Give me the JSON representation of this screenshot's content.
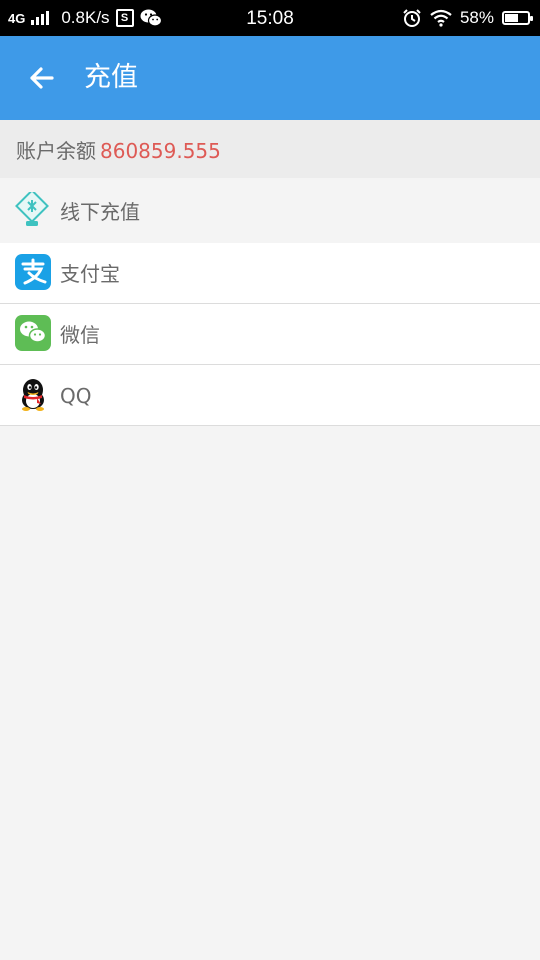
{
  "status_bar": {
    "network": "4G",
    "speed": "0.8K/s",
    "time": "15:08",
    "battery": "58%",
    "battery_level": 0.58
  },
  "app_bar": {
    "title": "充值"
  },
  "balance": {
    "label": "账户余额",
    "amount": "860859.555",
    "amount_color": "#de5a55"
  },
  "payment_methods": [
    {
      "label": "线下充值",
      "icon": "offline-recharge-icon"
    },
    {
      "label": "支付宝",
      "icon": "alipay-icon"
    },
    {
      "label": "微信",
      "icon": "wechat-icon"
    },
    {
      "label": "QQ",
      "icon": "qq-icon"
    }
  ],
  "colors": {
    "app_bar": "#3e9ae8",
    "alipay": "#1aa1e6",
    "wechat": "#5ebd55"
  }
}
